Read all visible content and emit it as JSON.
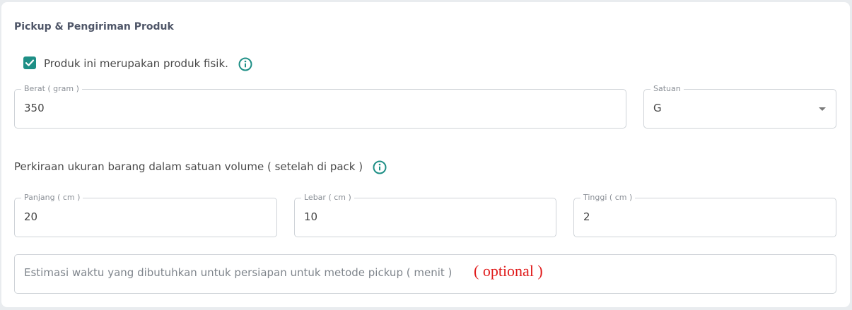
{
  "section": {
    "title": "Pickup & Pengiriman Produk"
  },
  "physical_product": {
    "checked": true,
    "label": "Produk ini merupakan produk fisik."
  },
  "weight": {
    "label": "Berat ( gram )",
    "value": "350"
  },
  "unit": {
    "label": "Satuan",
    "value": "G"
  },
  "volume": {
    "label": "Perkiraan ukuran barang dalam satuan volume ( setelah di pack )"
  },
  "length": {
    "label": "Panjang ( cm )",
    "value": "20"
  },
  "width": {
    "label": "Lebar ( cm )",
    "value": "10"
  },
  "height": {
    "label": "Tinggi ( cm )",
    "value": "2"
  },
  "pickup_estimate": {
    "placeholder": "Estimasi waktu yang dibutuhkan untuk persiapan untuk metode pickup ( menit )",
    "annotation": "( optional )"
  },
  "colors": {
    "accent": "#1e8f86",
    "annotation": "#e01b1b"
  }
}
